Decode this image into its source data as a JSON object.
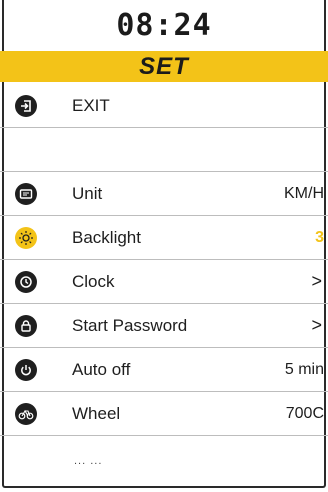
{
  "header": {
    "time": "08:24",
    "title": "SET"
  },
  "exit": {
    "label": "EXIT",
    "icon": "exit-icon"
  },
  "settings": [
    {
      "label": "Unit",
      "value": "KM/H",
      "icon": "speedometer-icon"
    },
    {
      "label": "Backlight",
      "value": "3",
      "icon": "sun-icon"
    },
    {
      "label": "Clock",
      "value": ">",
      "icon": "clock-icon"
    },
    {
      "label": "Start Password",
      "value": ">",
      "icon": "lock-icon"
    },
    {
      "label": "Auto off",
      "value": "5 min",
      "icon": "power-icon"
    },
    {
      "label": "Wheel",
      "value": "700C",
      "icon": "bicycle-icon"
    }
  ],
  "more": "... ...",
  "colors": {
    "accent": "#f3c318",
    "text": "#1e1e1e",
    "icon_bg": "#1f1f1f",
    "divider": "#bdbdbd"
  }
}
